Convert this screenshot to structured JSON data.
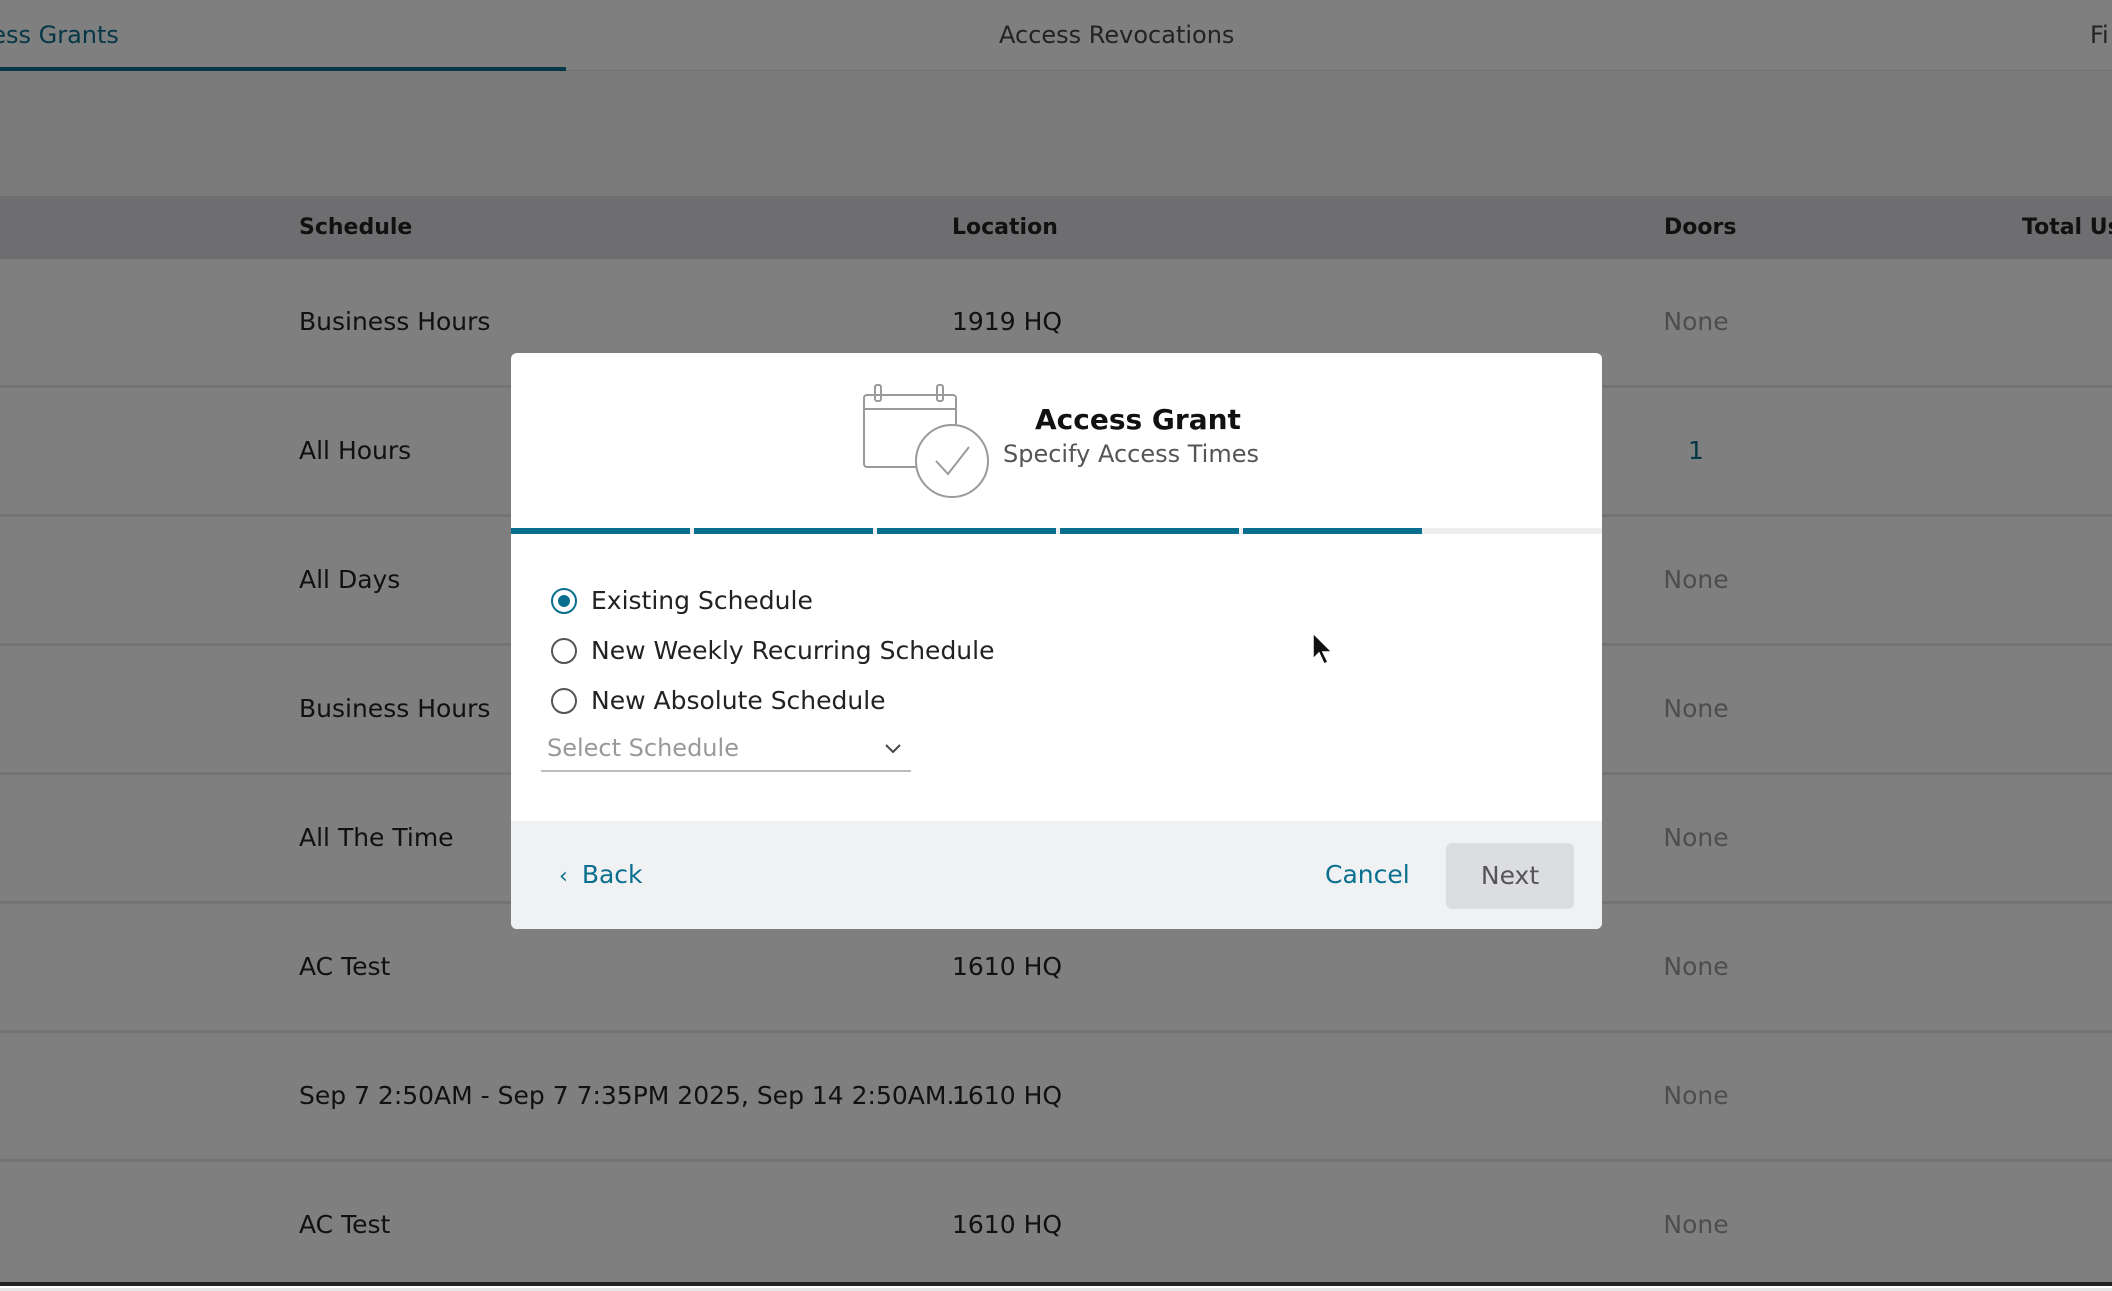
{
  "tabs": {
    "items": [
      {
        "label": "cess Grants"
      },
      {
        "label": "Access Revocations"
      },
      {
        "label": "Fi"
      }
    ]
  },
  "table": {
    "headers": {
      "schedule": "Schedule",
      "location": "Location",
      "doors": "Doors",
      "total_users": "Total Us"
    },
    "rows": [
      {
        "schedule": "Business Hours",
        "location": "1919 HQ",
        "doors": "None"
      },
      {
        "schedule": "All Hours",
        "location": "",
        "doors": "1"
      },
      {
        "schedule": "All Days",
        "location": "",
        "doors": "None"
      },
      {
        "schedule": "Business Hours",
        "location": "",
        "doors": "None"
      },
      {
        "schedule": "All The Time",
        "location": "",
        "doors": "None"
      },
      {
        "schedule": "AC Test",
        "location": "1610 HQ",
        "doors": "None"
      },
      {
        "schedule": "Sep 7 2:50AM - Sep 7 7:35PM 2025, Sep 14 2:50AM...",
        "location": "1610 HQ",
        "doors": "None"
      },
      {
        "schedule": "AC Test",
        "location": "1610 HQ",
        "doors": "None"
      }
    ]
  },
  "modal": {
    "title": "Access Grant",
    "subtitle": "Specify Access Times",
    "progress": {
      "completed_steps": 5,
      "total_steps": 6
    },
    "options": [
      {
        "label": "Existing Schedule",
        "checked": true
      },
      {
        "label": "New Weekly Recurring Schedule",
        "checked": false
      },
      {
        "label": "New Absolute Schedule",
        "checked": false
      }
    ],
    "select": {
      "placeholder": "Select Schedule"
    },
    "footer": {
      "back_label": "Back",
      "cancel_label": "Cancel",
      "next_label": "Next"
    }
  },
  "colors": {
    "accent": "#0a6f8f",
    "overlay": "rgba(0,0,0,0.5)"
  }
}
